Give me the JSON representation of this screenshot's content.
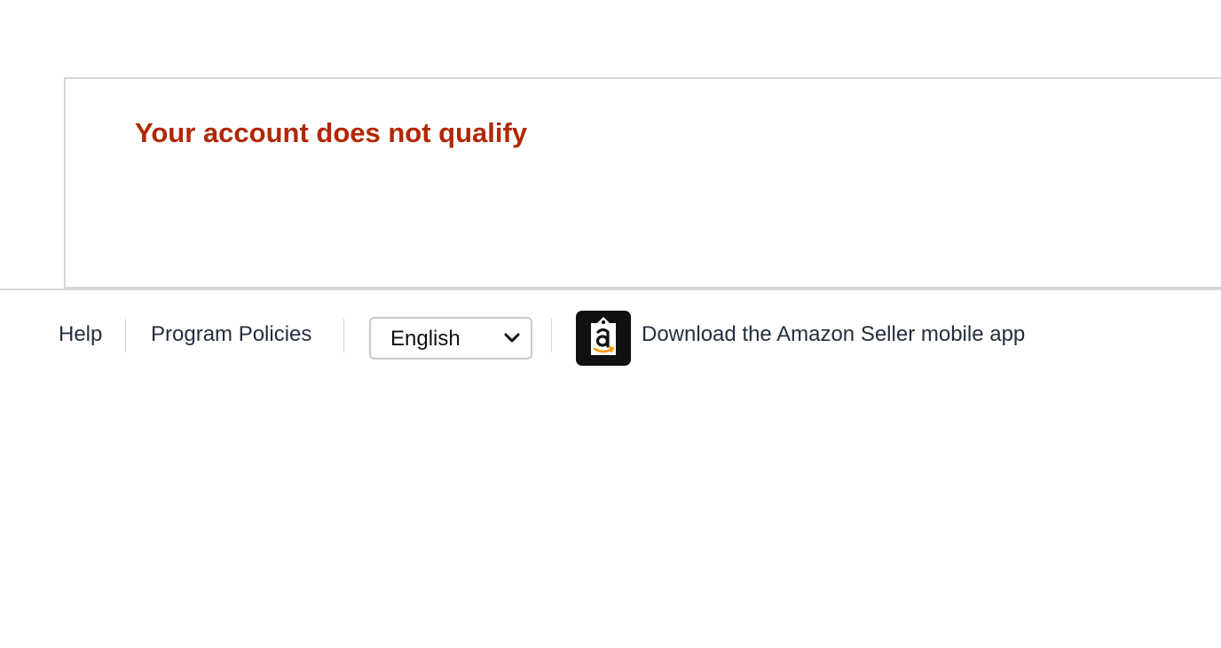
{
  "message": {
    "title": "Your account does not qualify"
  },
  "footer": {
    "help_label": "Help",
    "program_policies_label": "Program Policies",
    "language": {
      "selected": "English"
    },
    "app_icon": "amazon-seller-app-icon",
    "app_link_label": "Download the Amazon Seller mobile app"
  },
  "colors": {
    "error_title": "#b12704",
    "link_text": "#232f3e",
    "divider": "#d5d9d9"
  }
}
